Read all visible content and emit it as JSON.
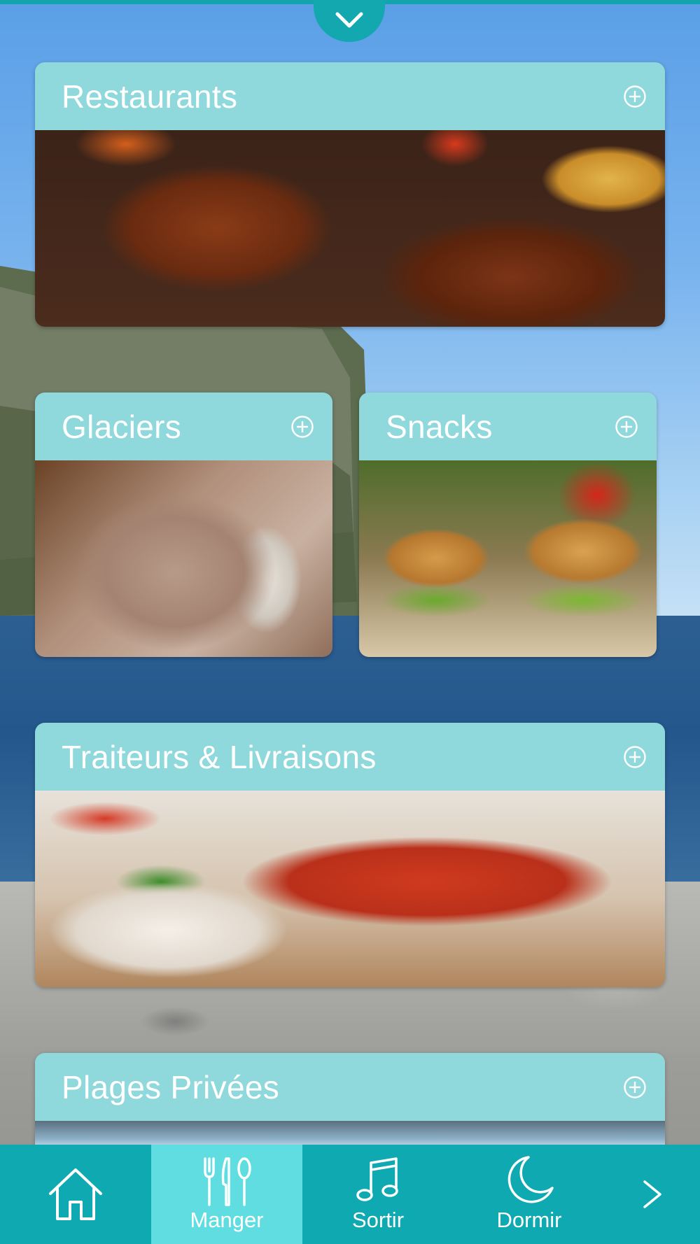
{
  "categories": {
    "restaurants": {
      "title": "Restaurants",
      "icon": "plus-circle-icon"
    },
    "glaciers": {
      "title": "Glaciers",
      "icon": "plus-circle-icon"
    },
    "snacks": {
      "title": "Snacks",
      "icon": "plus-circle-icon"
    },
    "traiteurs": {
      "title": "Traiteurs & Livraisons",
      "icon": "plus-circle-icon"
    },
    "plages": {
      "title": "Plages Privées",
      "icon": "plus-circle-icon"
    }
  },
  "pull_handle": {
    "icon": "chevron-down-icon"
  },
  "tabbar": {
    "tabs": [
      {
        "label": "",
        "icon": "home-icon",
        "active": false
      },
      {
        "label": "Manger",
        "icon": "fork-knife-spoon-icon",
        "active": true
      },
      {
        "label": "Sortir",
        "icon": "music-note-icon",
        "active": false
      },
      {
        "label": "Dormir",
        "icon": "moon-icon",
        "active": false
      }
    ],
    "next_icon": "chevron-right-icon"
  },
  "colors": {
    "accent": "#13a8b0",
    "card_header": "#8fd8dc",
    "tab_active": "#5fdde1",
    "text": "#ffffff"
  }
}
